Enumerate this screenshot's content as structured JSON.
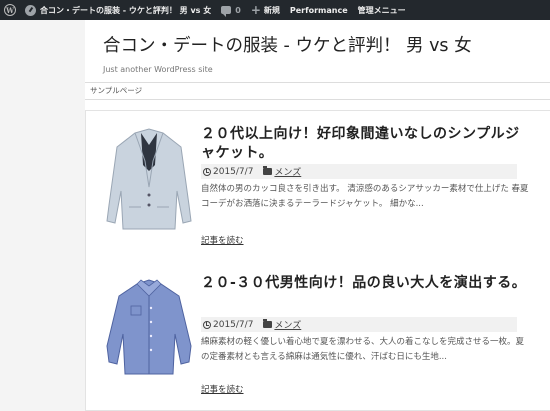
{
  "adminbar": {
    "site_name": "合コン・デートの服装 - ウケと評判！ 男 vs 女",
    "comments_count": "0",
    "new_label": "新規",
    "performance_label": "Performance",
    "admin_menu_label": "管理メニュー"
  },
  "site": {
    "title": "合コン・デートの服装 - ウケと評判！ 男 vs 女",
    "tagline": "Just another WordPress site"
  },
  "nav": {
    "items": [
      {
        "label": "サンプルページ"
      }
    ]
  },
  "posts": [
    {
      "title": "２０代以上向け！好印象間違いなしのシンプルジャケット。",
      "date": "2015/7/7",
      "category": "メンズ",
      "excerpt": "自然体の男のカッコ良さを引き出す。 清涼感のあるシアサッカー素材で仕上げた 春夏コーデがお洒落に決まるテーラードジャケット。 細かな...",
      "read_more": "記事を読む",
      "thumb_icon": "jacket-icon"
    },
    {
      "title": "２０-３０代男性向け！品の良い大人を演出する。",
      "date": "2015/7/7",
      "category": "メンズ",
      "excerpt": "綿麻素材の軽く優しい着心地で夏を漂わせる、大人の着こなしを完成させる一枚。夏の定番素材とも言える綿麻は通気性に優れ、汗ばむ日にも生地...",
      "read_more": "記事を読む",
      "thumb_icon": "shirt-icon"
    }
  ],
  "colors": {
    "adminbar_bg": "#23282d",
    "jacket": "#c9d3de",
    "shirt": "#7f94cc"
  }
}
